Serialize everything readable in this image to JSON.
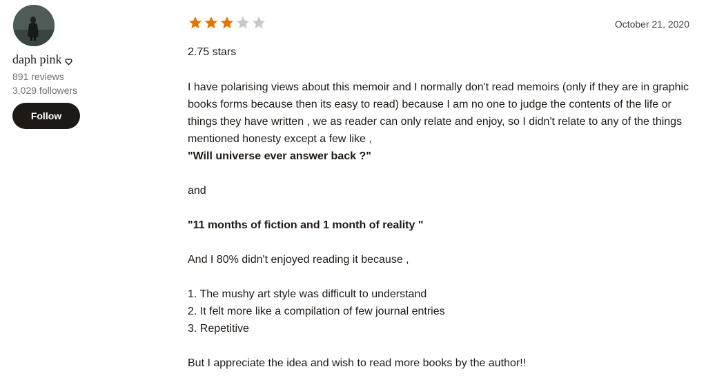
{
  "reviewer": {
    "name": "daph pink",
    "reviews": "891 reviews",
    "followers": "3,029 followers",
    "follow_label": "Follow",
    "avatar_icon": "profile-photo-avatar",
    "heart_icon": "heart-outline-icon"
  },
  "review": {
    "rating": 3,
    "max_rating": 5,
    "date": "October 21, 2020",
    "rating_text": "2.75 stars",
    "paragraph_1": "I have polarising views about this memoir and I normally don't read memoirs (only if they are in graphic books forms because then its easy to read) because I am no one to judge the contents of the life or things they have written , we as reader can only relate and enjoy, so I didn't relate to any of the things mentioned honesty except a few like ,",
    "quote_1": "\"Will universe ever answer back ?\"",
    "and_text": "and",
    "quote_2": "\"11 months of fiction and 1 month of reality \"",
    "paragraph_2": "And I 80% didn't enjoyed reading it because ,",
    "list": [
      "1. The mushy art style was difficult to understand",
      "2. It felt more like a compilation of few journal entries",
      "3. Repetitive"
    ],
    "closing": "But I appreciate the idea and wish to read more books by the author!!"
  },
  "colors": {
    "star_filled": "#e87400",
    "star_empty": "#c8c8c8",
    "button_bg": "#1e1915",
    "text_primary": "#1e1915",
    "text_secondary": "#707070"
  }
}
